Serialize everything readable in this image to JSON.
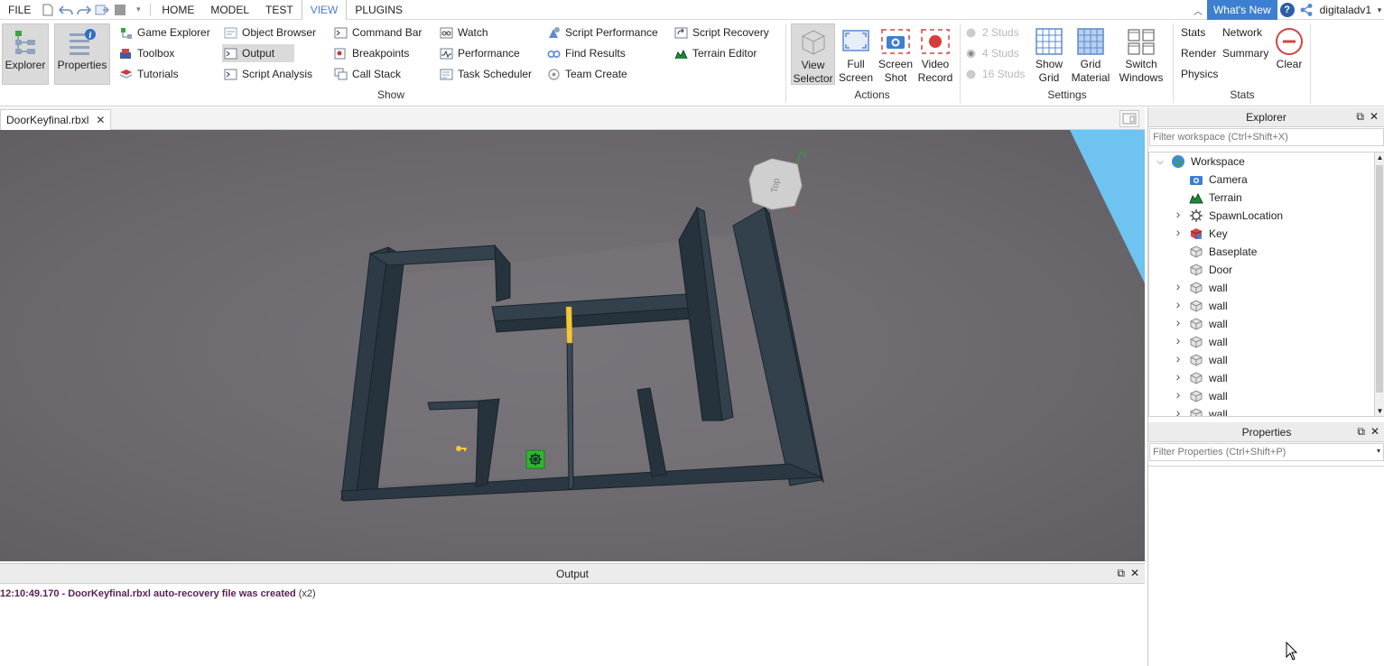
{
  "menu": {
    "file": "FILE",
    "tabs": [
      "HOME",
      "MODEL",
      "TEST",
      "VIEW",
      "PLUGINS"
    ],
    "active_tab": "VIEW"
  },
  "top_right": {
    "whats_new": "What's New",
    "username": "digitaladv1"
  },
  "ribbon": {
    "explorer": "Explorer",
    "properties": "Properties",
    "col1": [
      "Game Explorer",
      "Toolbox",
      "Tutorials"
    ],
    "col2": [
      "Object Browser",
      "Output",
      "Script Analysis"
    ],
    "col3": [
      "Command Bar",
      "Breakpoints",
      "Call Stack"
    ],
    "col4": [
      "Watch",
      "Performance",
      "Task Scheduler"
    ],
    "col5": [
      "Script Performance",
      "Find Results",
      "Team Create"
    ],
    "col6": [
      "Script Recovery",
      "Terrain Editor"
    ],
    "show_label": "Show",
    "actions": [
      {
        "l1": "View",
        "l2": "Selector"
      },
      {
        "l1": "Full",
        "l2": "Screen"
      },
      {
        "l1": "Screen",
        "l2": "Shot"
      },
      {
        "l1": "Video",
        "l2": "Record"
      }
    ],
    "actions_label": "Actions",
    "studs": [
      "2 Studs",
      "4 Studs",
      "16 Studs"
    ],
    "settings": [
      {
        "l1": "Show",
        "l2": "Grid"
      },
      {
        "l1": "Grid",
        "l2": "Material"
      },
      {
        "l1": "Switch",
        "l2": "Windows"
      }
    ],
    "settings_label": "Settings",
    "stats": [
      "Stats",
      "Network",
      "Render",
      "Summary",
      "Physics"
    ],
    "clear": "Clear",
    "stats_label": "Stats"
  },
  "document": {
    "tab_title": "DoorKeyfinal.rbxl"
  },
  "viewport": {
    "view_cube_label": "Top",
    "axis_label": "Y"
  },
  "output": {
    "title": "Output",
    "line_time": "12:10:49.170 - ",
    "line_msg": "DoorKeyfinal.rbxl auto-recovery file was created",
    "line_count": " (x2)"
  },
  "explorer": {
    "title": "Explorer",
    "filter_placeholder": "Filter workspace (Ctrl+Shift+X)",
    "items": [
      {
        "label": "Workspace",
        "depth": 0,
        "expanded": true
      },
      {
        "label": "Camera",
        "depth": 1
      },
      {
        "label": "Terrain",
        "depth": 1
      },
      {
        "label": "SpawnLocation",
        "depth": 1,
        "expandable": true
      },
      {
        "label": "Key",
        "depth": 1,
        "expandable": true
      },
      {
        "label": "Baseplate",
        "depth": 1
      },
      {
        "label": "Door",
        "depth": 1
      },
      {
        "label": "wall",
        "depth": 1,
        "expandable": true
      },
      {
        "label": "wall",
        "depth": 1,
        "expandable": true
      },
      {
        "label": "wall",
        "depth": 1,
        "expandable": true
      },
      {
        "label": "wall",
        "depth": 1,
        "expandable": true
      },
      {
        "label": "wall",
        "depth": 1,
        "expandable": true
      },
      {
        "label": "wall",
        "depth": 1,
        "expandable": true
      },
      {
        "label": "wall",
        "depth": 1,
        "expandable": true
      },
      {
        "label": "wall",
        "depth": 1,
        "expandable": true
      }
    ]
  },
  "properties": {
    "title": "Properties",
    "filter_placeholder": "Filter Properties (Ctrl+Shift+P)"
  },
  "colors": {
    "accent": "#3d7fd0",
    "wall": "#26323c",
    "ground": "#6d6a6f",
    "door": "#f2c73a",
    "spawn": "#2fb52f",
    "output_msg": "#5a1f55"
  }
}
